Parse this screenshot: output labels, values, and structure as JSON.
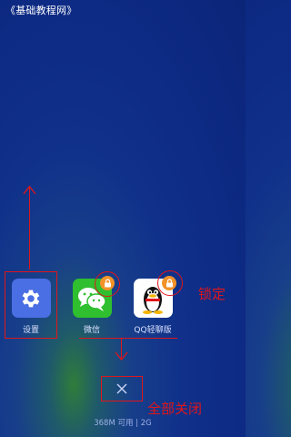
{
  "watermark": "《基础教程网》",
  "apps": [
    {
      "name": "设置",
      "icon": "gear-icon"
    },
    {
      "name": "微信",
      "icon": "wechat-icon",
      "locked": true
    },
    {
      "name": "QQ轻聊版",
      "icon": "qq-penguin-icon",
      "locked": true
    }
  ],
  "annotations": {
    "lock_label": "锁定",
    "close_all_label": "全部关闭"
  },
  "memory": "368M 可用 | 2G",
  "colors": {
    "annotation": "#e0161b",
    "lock_badge": "#f2932a",
    "background": "#0d2a84"
  }
}
